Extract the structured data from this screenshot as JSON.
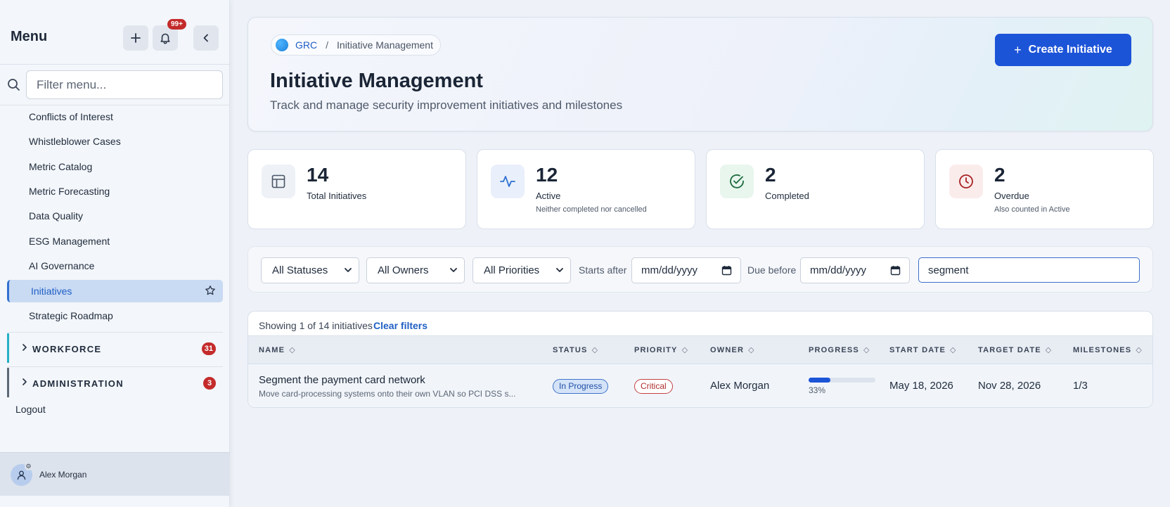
{
  "sidebar": {
    "title": "Menu",
    "notification_badge": "99+",
    "filter_placeholder": "Filter menu...",
    "items": [
      {
        "label": "Conflicts of Interest"
      },
      {
        "label": "Whistleblower Cases"
      },
      {
        "label": "Metric Catalog"
      },
      {
        "label": "Metric Forecasting"
      },
      {
        "label": "Data Quality"
      },
      {
        "label": "ESG Management"
      },
      {
        "label": "AI Governance"
      },
      {
        "label": "Initiatives",
        "active": true
      },
      {
        "label": "Strategic Roadmap"
      }
    ],
    "groups": [
      {
        "label": "WORKFORCE",
        "badge": "31",
        "accent": "#26b0c7"
      },
      {
        "label": "ADMINISTRATION",
        "badge": "3",
        "accent": "#5d6876"
      }
    ],
    "logout": "Logout",
    "user_name": "Alex Morgan"
  },
  "header": {
    "breadcrumb_root": "GRC",
    "breadcrumb_sep": "/",
    "breadcrumb_current": "Initiative Management",
    "title": "Initiative Management",
    "subtitle": "Track and manage security improvement initiatives and milestones",
    "create_label": "Create Initiative"
  },
  "stats": [
    {
      "value": "14",
      "label": "Total Initiatives",
      "note": "",
      "icon": "table-icon",
      "color": "#4a5565"
    },
    {
      "value": "12",
      "label": "Active",
      "note": "Neither completed nor cancelled",
      "icon": "activity-icon",
      "color": "#2f6fd0"
    },
    {
      "value": "2",
      "label": "Completed",
      "note": "",
      "icon": "check-circle-icon",
      "color": "#1e8a4c"
    },
    {
      "value": "2",
      "label": "Overdue",
      "note": "Also counted in Active",
      "icon": "clock-icon",
      "color": "#b32626"
    }
  ],
  "filters": {
    "status": "All Statuses",
    "owner": "All Owners",
    "priority": "All Priorities",
    "starts_after_label": "Starts after",
    "due_before_label": "Due before",
    "date_placeholder": "mm/dd/yyyy",
    "search_value": "segment"
  },
  "table": {
    "showing": "Showing 1 of 14 initiatives",
    "clear_filters": "Clear filters",
    "columns": [
      "NAME",
      "STATUS",
      "PRIORITY",
      "OWNER",
      "PROGRESS",
      "START DATE",
      "TARGET DATE",
      "MILESTONES"
    ],
    "rows": [
      {
        "name": "Segment the payment card network",
        "description": "Move card-processing systems onto their own VLAN so PCI DSS s...",
        "status": "In Progress",
        "priority": "Critical",
        "owner": "Alex Morgan",
        "progress": 33,
        "progress_text": "33%",
        "start_date": "May 18, 2026",
        "target_date": "Nov 28, 2026",
        "milestones": "1/3"
      }
    ]
  }
}
